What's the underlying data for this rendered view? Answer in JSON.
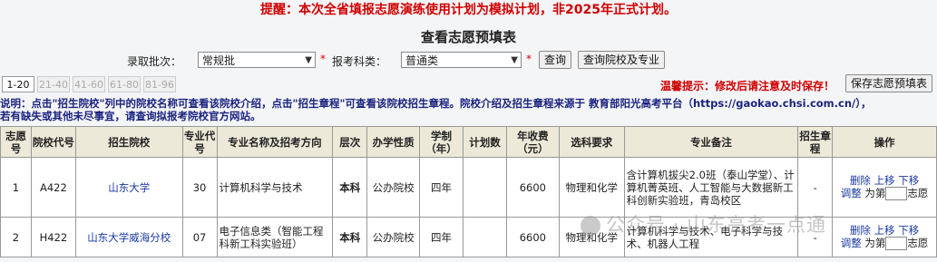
{
  "notice": "提醒：本次全省填报志愿演练使用计划为模拟计划，非2025年正式计划。",
  "page_title": "查看志愿预填表",
  "filters": {
    "batch_label": "录取批次：",
    "batch_value": "常规批",
    "subject_label": "报考科类：",
    "subject_value": "普通类",
    "required_mark": "*",
    "query_button": "查询",
    "query_school_button": "查询院校及专业"
  },
  "tabs": [
    "1-20",
    "21-40",
    "41-60",
    "61-80",
    "81-96"
  ],
  "warm_tip": "温馨提示：修改后请注意及时保存！",
  "save_button": "保存志愿预填表",
  "description": {
    "line1": "说明：点击\"招生院校\"列中的院校名称可查看该院校介绍，点击\"招生章程\"可查看该院校招生章程。院校介绍及招生章程来源于 教育部阳光高考平台（https://gaokao.chsi.com.cn/），",
    "line2": "若有缺失或其他未尽事宜，请查询拟报考院校官方网站。"
  },
  "table": {
    "headers": {
      "h0": "志愿号",
      "h1": "院校代号",
      "h2": "招生院校",
      "h3": "专业代号",
      "h4": "专业名称及招考方向",
      "h5": "层次",
      "h6": "办学性质",
      "h7": "学制（年）",
      "h8": "计划数",
      "h9": "年收费（元）",
      "h10": "选科要求",
      "h11": "专业备注",
      "h12": "招生章程",
      "h13": "操作"
    },
    "rows": [
      {
        "no": "1",
        "school_code": "A422",
        "school": "山东大学",
        "major_code": "30",
        "major": "计算机科学与技术",
        "level": "本科",
        "nature": "公办院校",
        "years": "四年",
        "plan": "",
        "fee": "6600",
        "subjects": "物理和化学",
        "remark": "含计算机拔尖2.0班（泰山学堂）、计算机菁英班、人工智能与大数据新工科创新实验班，青岛校区",
        "charter": "-",
        "op_delete": "删除",
        "op_up": "上移",
        "op_down": "下移",
        "op_adjust": "调整",
        "op_to": "为第",
        "op_suffix": "志愿"
      },
      {
        "no": "2",
        "school_code": "H422",
        "school": "山东大学威海分校",
        "major_code": "07",
        "major": "电子信息类（智能工程科新工科实验班）",
        "level": "本科",
        "nature": "公办院校",
        "years": "四年",
        "plan": "",
        "fee": "6600",
        "subjects": "物理和化学",
        "remark": "计算机科学与技术、电子科学与技术、机器人工程",
        "charter": "-",
        "op_delete": "删除",
        "op_up": "上移",
        "op_down": "下移",
        "op_adjust": "调整",
        "op_to": "为第",
        "op_suffix": "志愿"
      }
    ]
  },
  "watermark": "公众号 · 山东高考一点通"
}
